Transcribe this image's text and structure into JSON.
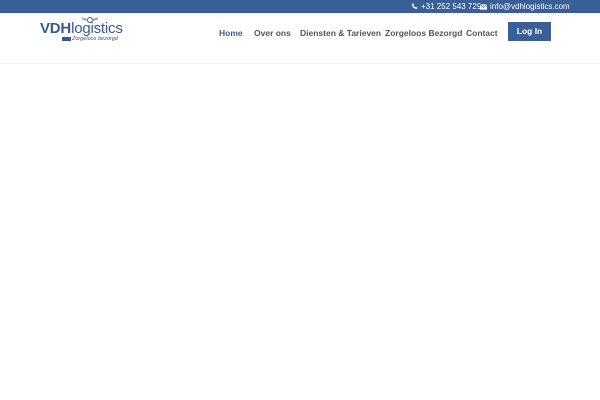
{
  "topbar": {
    "phone": "+31 252 543 729",
    "phone_icon": "phone-icon",
    "email": "info@vdhlogistics.com",
    "email_icon": "envelope-icon"
  },
  "logo": {
    "brand_bold": "VDH",
    "brand_rest": "logistics",
    "tagline": "Zorgeloos bezorgd"
  },
  "nav": {
    "items": [
      {
        "label": "Home",
        "active": true
      },
      {
        "label": "Over ons",
        "active": false
      },
      {
        "label": "Diensten & Tarieven",
        "active": false
      },
      {
        "label": "Zorgeloos Bezorgd",
        "active": false
      },
      {
        "label": "Contact",
        "active": false
      }
    ],
    "login_label": "Log In"
  },
  "colors": {
    "brand_blue": "#3a5f97",
    "nav_text": "#555555",
    "background": "#ffffff"
  }
}
